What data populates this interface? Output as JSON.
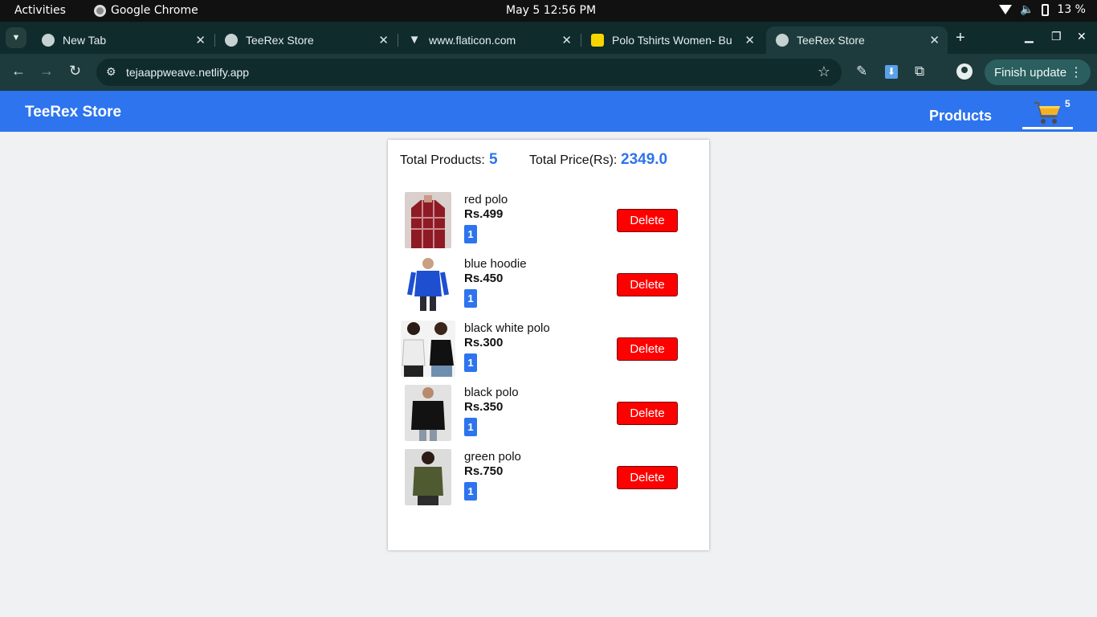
{
  "os": {
    "activities": "Activities",
    "app_name": "Google Chrome",
    "clock": "May 5  12:56 PM",
    "battery": "13 %"
  },
  "browser": {
    "tabs": [
      {
        "title": "New Tab",
        "icon": "globe-icon"
      },
      {
        "title": "TeeRex Store",
        "icon": "globe-icon"
      },
      {
        "title": "www.flaticon.com",
        "icon": "flaticon-icon"
      },
      {
        "title": "Polo Tshirts Women- Bu",
        "icon": "flipkart-icon"
      },
      {
        "title": "TeeRex Store",
        "icon": "globe-icon",
        "active": true
      }
    ],
    "url": "tejaappweave.netlify.app",
    "finish_update": "Finish update"
  },
  "site": {
    "brand": "TeeRex Store",
    "nav_products": "Products",
    "cart_count": "5",
    "colors": {
      "header": "#2d74ee",
      "delete": "#ff0000",
      "accent": "#2d74ee"
    }
  },
  "cart": {
    "total_products_label": "Total Products:",
    "total_products": "5",
    "total_price_label": "Total Price(Rs):",
    "total_price": "2349.0",
    "items": [
      {
        "name": "red polo",
        "price": "Rs.499",
        "qty": "1",
        "delete": "Delete"
      },
      {
        "name": "blue hoodie",
        "price": "Rs.450",
        "qty": "1",
        "delete": "Delete"
      },
      {
        "name": "black white polo",
        "price": "Rs.300",
        "qty": "1",
        "delete": "Delete"
      },
      {
        "name": "black polo",
        "price": "Rs.350",
        "qty": "1",
        "delete": "Delete"
      },
      {
        "name": "green polo",
        "price": "Rs.750",
        "qty": "1",
        "delete": "Delete"
      }
    ]
  }
}
